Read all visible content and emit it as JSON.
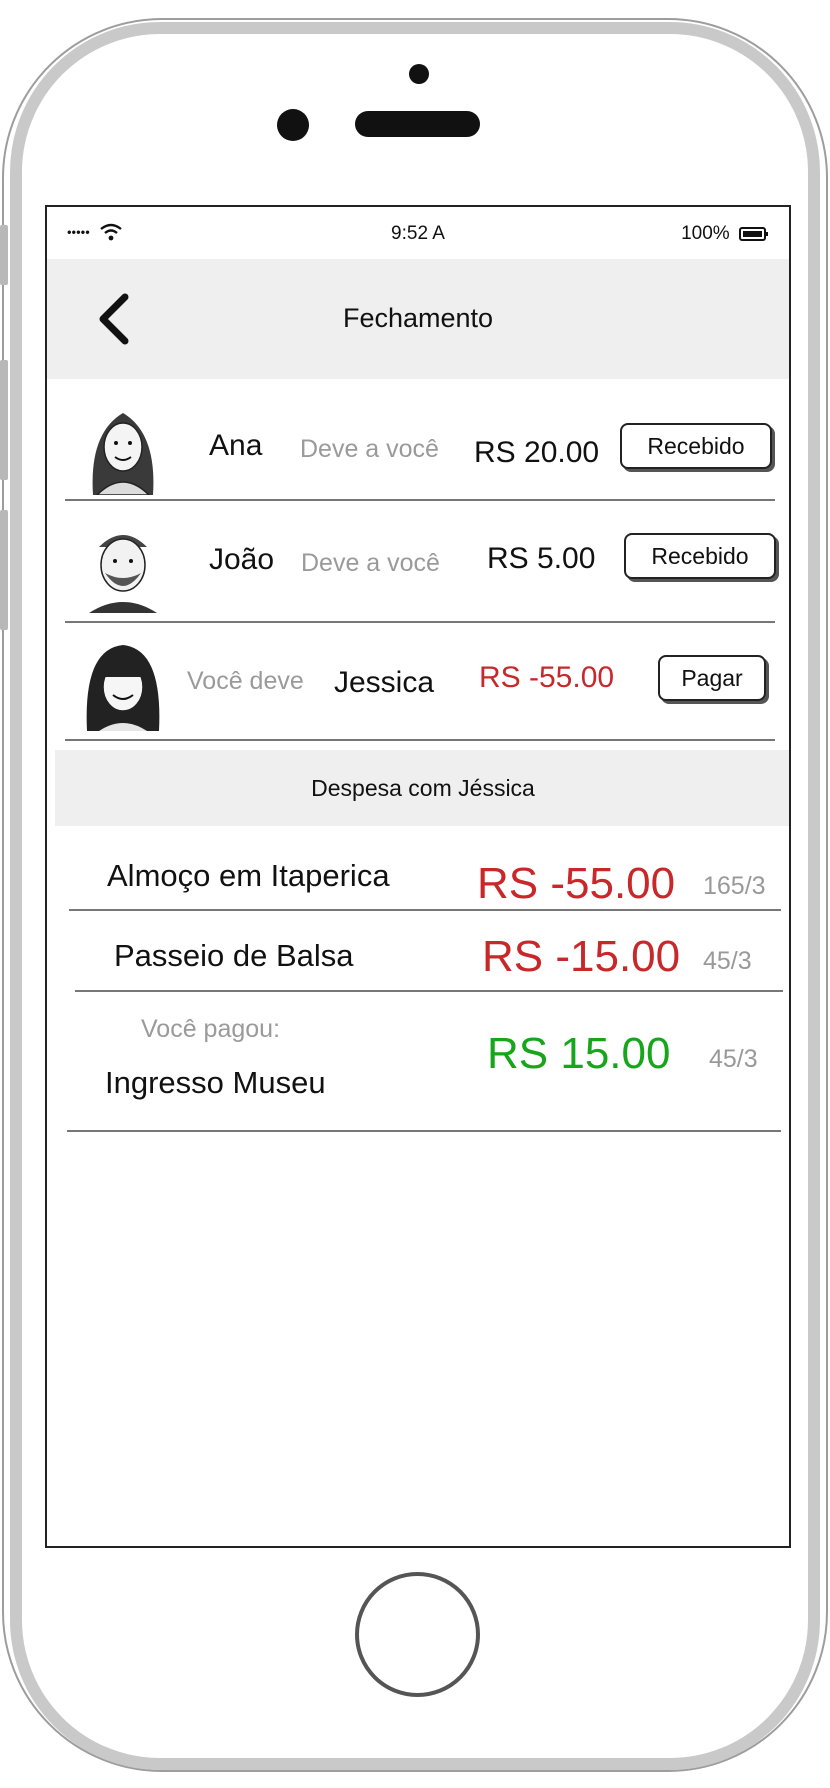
{
  "statusbar": {
    "signal": "•••••",
    "time": "9:52 A",
    "battery": "100%"
  },
  "navbar": {
    "title": "Fechamento"
  },
  "balances": [
    {
      "name": "Ana",
      "relation": "Deve a você",
      "amount": "RS 20.00",
      "action": "Recebido"
    },
    {
      "name": "João",
      "relation": "Deve a você",
      "amount": "RS 5.00",
      "action": "Recebido"
    },
    {
      "name": "Jessica",
      "relation": "Você deve",
      "amount": "RS -55.00",
      "action": "Pagar"
    }
  ],
  "section": {
    "title": "Despesa com Jéssica"
  },
  "expenses": [
    {
      "name": "Almoço em Itaperica",
      "amount": "RS -55.00",
      "fraction": "165/3"
    },
    {
      "name": "Passeio de Balsa",
      "amount": "RS -15.00",
      "fraction": "45/3"
    },
    {
      "note": "Você pagou:",
      "name": "Ingresso Museu",
      "amount": "RS 15.00",
      "fraction": "45/3"
    }
  ],
  "colors": {
    "negative": "#c8282a",
    "positive": "#17a51a",
    "header_bg": "#efefef"
  }
}
